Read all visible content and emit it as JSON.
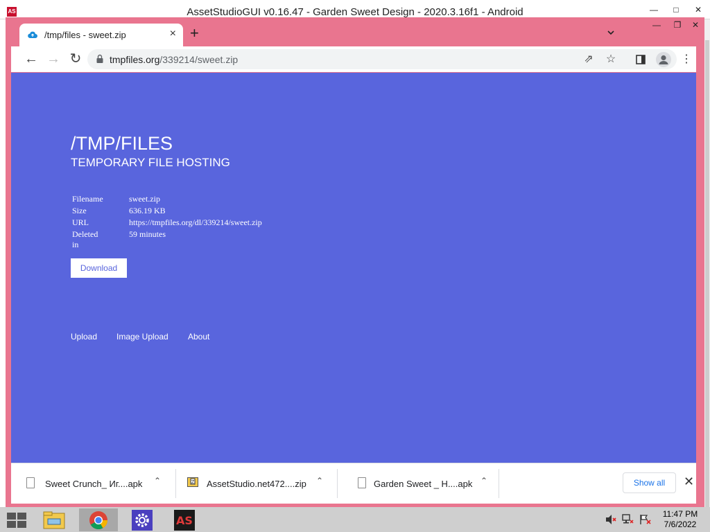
{
  "outer_window": {
    "title": "AssetStudioGUI v0.16.47 - Garden Sweet Design - 2020.3.16f1 - Android",
    "logo": "AS"
  },
  "browser": {
    "tab": {
      "title": "/tmp/files - sweet.zip"
    },
    "address": {
      "host": "tmpfiles.org",
      "path": "/339214/sweet.zip"
    },
    "icons": [
      "back-icon",
      "forward-icon",
      "reload-icon",
      "lock-icon",
      "share-icon",
      "star-icon",
      "side-panel-icon",
      "profile-icon",
      "menu-icon"
    ]
  },
  "page": {
    "title": "/TMP/FILES",
    "subtitle": "TEMPORARY FILE HOSTING",
    "info": [
      {
        "key": "Filename",
        "value": "sweet.zip"
      },
      {
        "key": "Size",
        "value": "636.19 KB"
      },
      {
        "key": "URL",
        "value": "https://tmpfiles.org/dl/339214/sweet.zip"
      },
      {
        "key": "Deleted in",
        "value": "59 minutes"
      }
    ],
    "download_label": "Download",
    "footer_links": [
      "Upload",
      "Image Upload",
      "About"
    ],
    "background_color": "#5965dd"
  },
  "downloads": {
    "items": [
      {
        "name": "Sweet Crunch_ Иг....apk"
      },
      {
        "name": "AssetStudio.net472....zip"
      },
      {
        "name": "Garden Sweet _ H....apk"
      }
    ],
    "show_all_label": "Show all"
  },
  "taskbar": {
    "apps": [
      "file-explorer-icon",
      "chrome-icon",
      "settings-icon",
      "assetstudio-icon"
    ],
    "assetstudio_label": "AS",
    "clock_time": "11:47 PM",
    "clock_date": "7/6/2022"
  }
}
